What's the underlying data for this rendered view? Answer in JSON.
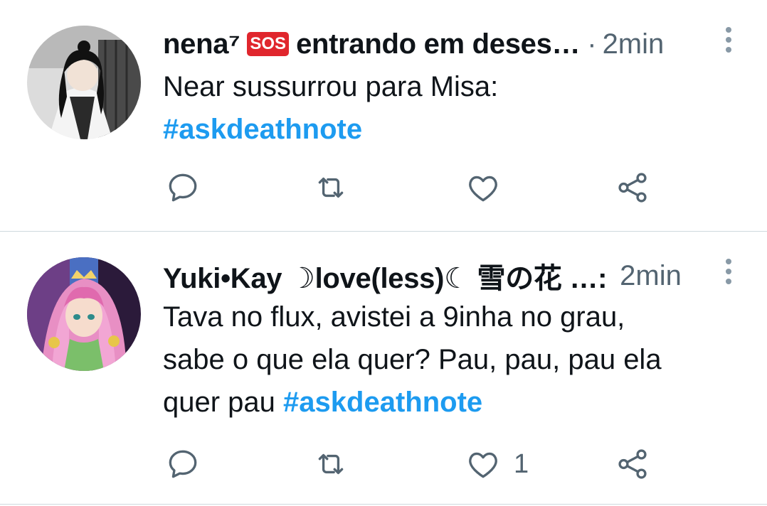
{
  "tweets": [
    {
      "name": "nena⁷",
      "badge": "SOS",
      "name_suffix": "entrando em deses…",
      "separator": "·",
      "time": "2min",
      "text_lines": [
        "Near sussurrou para Misa:"
      ],
      "hashtag": "#askdeathnote",
      "reply_count": "",
      "retweet_count": "",
      "like_count": "",
      "avatar_icon": "avatar-dark-haired-anime-character"
    },
    {
      "name": "Yuki•Kay ☽love(less)☾ 雪の花 …:",
      "separator": "",
      "time": "2min",
      "text_lines": [
        "Tava no flux, avistei a 9inha no grau,",
        "sabe o que ela quer? Pau, pau, pau ela",
        "quer pau "
      ],
      "hashtag": "#askdeathnote",
      "reply_count": "",
      "retweet_count": "",
      "like_count": "1",
      "avatar_icon": "avatar-pink-haired-anime-character"
    }
  ],
  "colors": {
    "link": "#1d9bf0",
    "secondary_text": "#536471",
    "icon": "#536471",
    "divider": "#cfd9de",
    "sos_badge": "#e0262d"
  }
}
